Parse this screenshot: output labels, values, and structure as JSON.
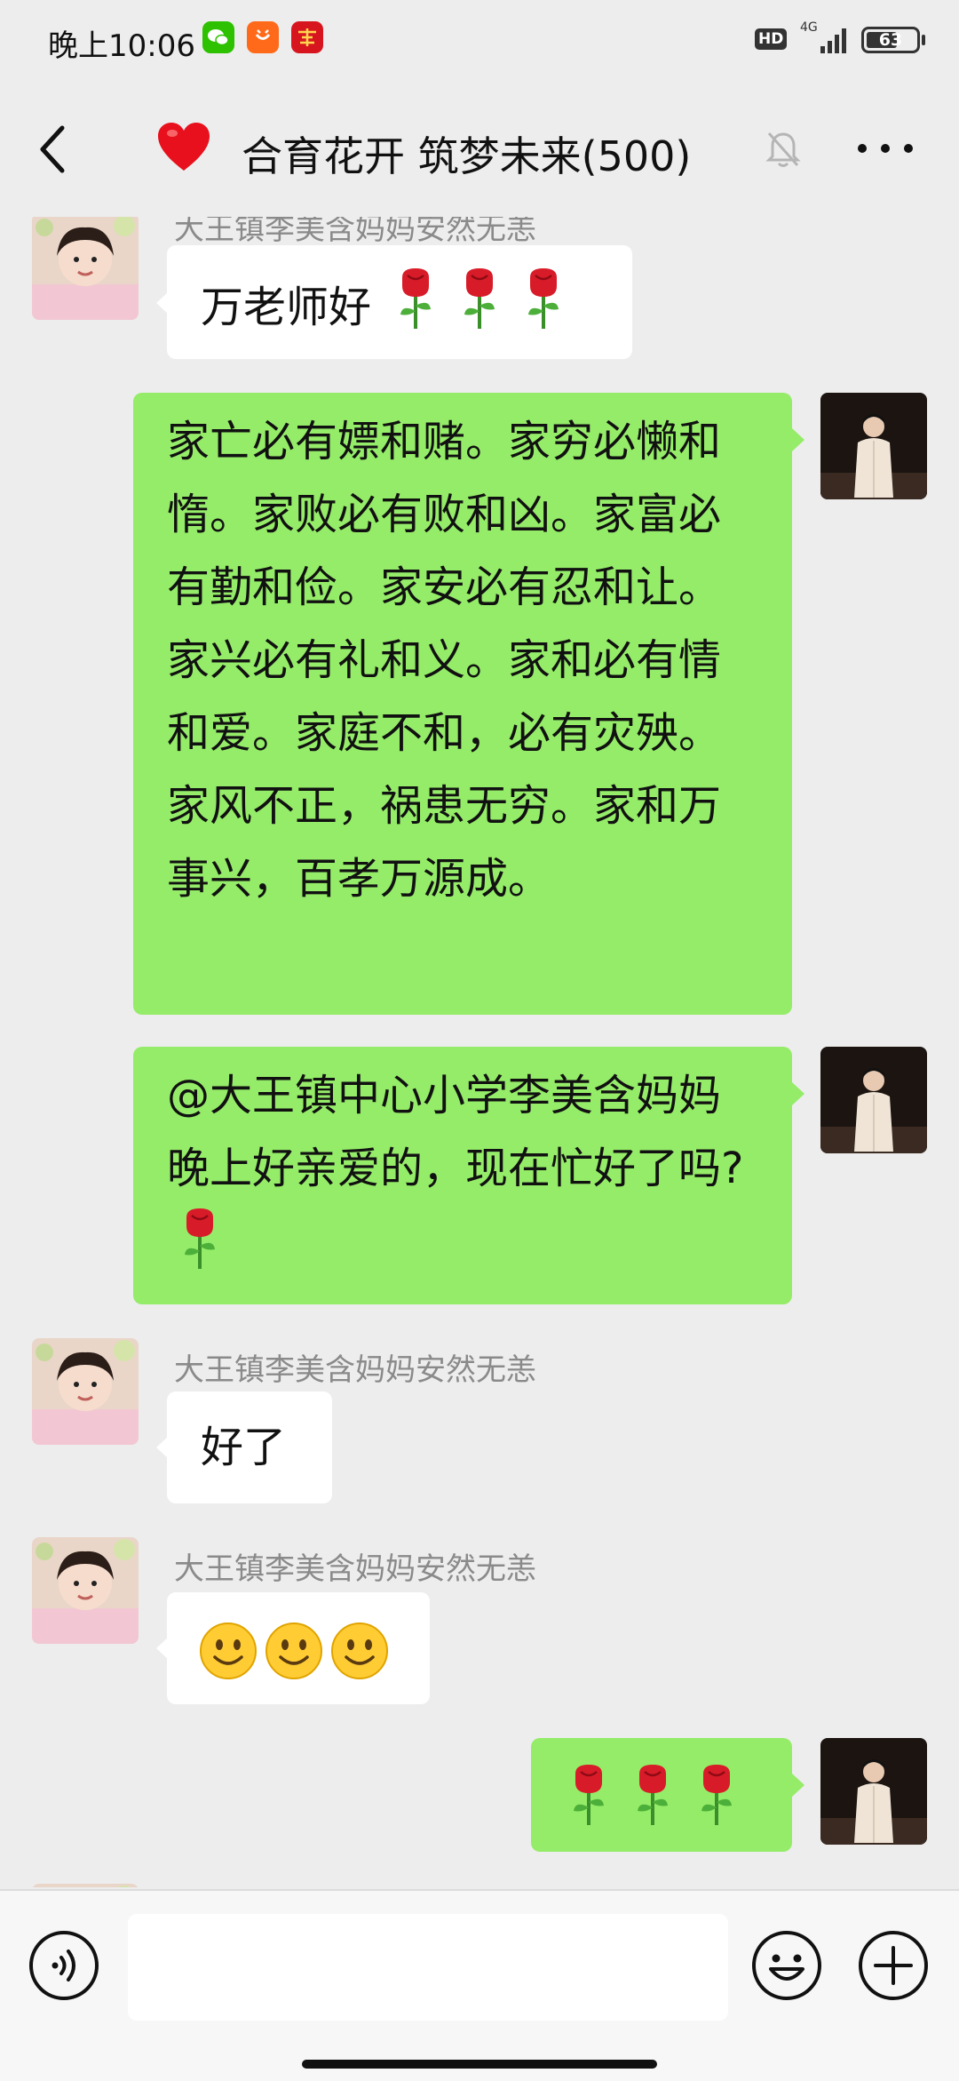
{
  "status_bar": {
    "time": "晚上10:06",
    "hd": "HD",
    "network": "4G",
    "battery": "63",
    "battery_level": 0.63
  },
  "nav": {
    "title": "合育花开 筑梦未来(500)",
    "heart_color": "#e8101c"
  },
  "messages": [
    {
      "id": "m1",
      "direction": "incoming",
      "sender": "大王镇李美含妈妈安然无恙",
      "text": "万老师好",
      "emoji": [
        "rose",
        "rose",
        "rose"
      ]
    },
    {
      "id": "m2",
      "direction": "outgoing",
      "text": "家亡必有嫖和赌。家穷必懒和惰。家败必有败和凶。家富必有勤和俭。家安必有忍和让。家兴必有礼和义。家和必有情和爱。家庭不和，必有灾殃。家风不正，祸患无穷。家和万事兴，百孝万源成。"
    },
    {
      "id": "m3",
      "direction": "outgoing",
      "text": "@大王镇中心小学李美含妈妈  晚上好亲爱的，现在忙好了吗?",
      "emoji": [
        "rose"
      ]
    },
    {
      "id": "m4",
      "direction": "incoming",
      "sender": "大王镇李美含妈妈安然无恙",
      "text": "好了"
    },
    {
      "id": "m5",
      "direction": "incoming",
      "sender": "大王镇李美含妈妈安然无恙",
      "text": "",
      "emoji": [
        "smile",
        "smile",
        "smile"
      ]
    },
    {
      "id": "m6",
      "direction": "outgoing",
      "text": "",
      "emoji": [
        "rose",
        "rose",
        "rose"
      ]
    }
  ],
  "colors": {
    "outgoing_bubble": "#95ec69",
    "incoming_bubble": "#ffffff",
    "background": "#ededed"
  },
  "icons": {
    "back": "chevron-left-icon",
    "mute": "bell-off-icon",
    "more": "more-icon",
    "voice": "voice-icon",
    "emoji": "emoji-icon",
    "plus": "plus-icon"
  }
}
